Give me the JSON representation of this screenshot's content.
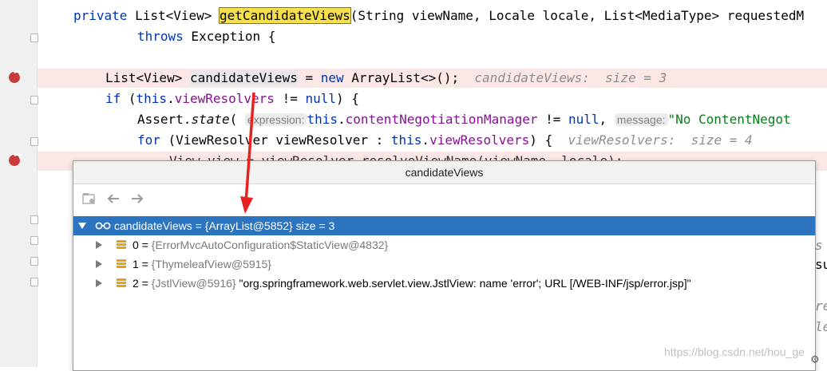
{
  "editor": {
    "line1": {
      "kw": "private",
      "t1": " List<View> ",
      "method": "getCandidateViews",
      "t2": "(String viewName, Locale locale, List<MediaType> requestedM"
    },
    "line2": {
      "kw": "throws",
      "t1": " Exception {"
    },
    "line3": {
      "t1": "List<View> ",
      "var": "candidateViews",
      "t2": " = ",
      "kw": "new",
      "t3": " ArrayList<>();",
      "inlay": "candidateViews:  size = 3"
    },
    "line4": {
      "kw": "if",
      "t1": " (",
      "kw2": "this",
      "dot": ".",
      "fld": "viewResolvers",
      "t2": " != ",
      "kw3": "null",
      "t3": ") {"
    },
    "line5": {
      "t1": "Assert.",
      "method": "state",
      "t2": "( ",
      "hint1": "expression:",
      "kw": "this",
      "dot": ".",
      "fld": "contentNegotiationManager",
      "t3": " != ",
      "kw2": "null",
      "t4": ", ",
      "hint2": "message:",
      "str": "\"No ContentNegot"
    },
    "line6": {
      "kw": "for",
      "t1": " (ViewResolver viewResolver : ",
      "kw2": "this",
      "dot": ".",
      "fld": "viewResolvers",
      "t2": ") {",
      "inlay": "viewResolvers:  size = 4"
    },
    "line7": {
      "t1": "View view = viewResolver.resolveViewName(viewName, locale);"
    },
    "right_frag": [
      "s",
      "su",
      "re",
      "le"
    ]
  },
  "popup": {
    "title": "candidateViews",
    "root": {
      "name": "candidateViews",
      "eq": " = ",
      "ref": "{ArrayList@5852}",
      "size": "  size = 3"
    },
    "items": [
      {
        "index": "0",
        "eq": " = ",
        "ref": "{ErrorMvcAutoConfiguration$StaticView@4832}",
        "extra": ""
      },
      {
        "index": "1",
        "eq": " = ",
        "ref": "{ThymeleafView@5915}",
        "extra": ""
      },
      {
        "index": "2",
        "eq": " = ",
        "ref": "{JstlView@5916}",
        "extra": " \"org.springframework.web.servlet.view.JstlView: name 'error'; URL [/WEB-INF/jsp/error.jsp]\""
      }
    ]
  },
  "watermark": "https://blog.csdn.net/hou_ge",
  "colors": {
    "selection": "#2d74c0",
    "breakpoint": "#c93b3b",
    "arrow": "#e8231f"
  }
}
